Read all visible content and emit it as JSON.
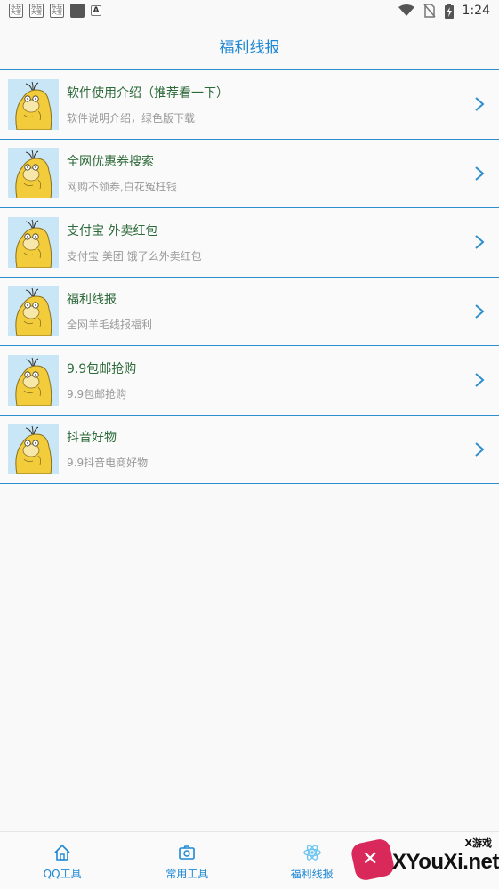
{
  "status_bar": {
    "notification_icons": [
      "app-notification-icon",
      "app-notification-icon",
      "app-notification-icon",
      "dark-square-icon",
      "a-letter-icon"
    ],
    "notif_label": "乐玩大宝",
    "time": "1:24",
    "icons": [
      "wifi-icon",
      "no-sim-icon",
      "battery-charging-icon"
    ]
  },
  "header": {
    "title": "福利线报"
  },
  "list": {
    "items": [
      {
        "title": "软件使用介绍（推荐看一下）",
        "subtitle": "软件说明介绍，绿色版下载"
      },
      {
        "title": "全网优惠券搜索",
        "subtitle": "网购不领券,白花冤枉钱"
      },
      {
        "title": "支付宝 外卖红包",
        "subtitle": "支付宝 美团 饿了么外卖红包"
      },
      {
        "title": "福利线报",
        "subtitle": "全网羊毛线报福利"
      },
      {
        "title": "9.9包邮抢购",
        "subtitle": "9.9包邮抢购"
      },
      {
        "title": "抖音好物",
        "subtitle": "9.9抖音电商好物"
      }
    ]
  },
  "tabbar": {
    "tabs": [
      {
        "label": "QQ工具",
        "icon": "home-icon"
      },
      {
        "label": "常用工具",
        "icon": "camera-icon"
      },
      {
        "label": "福利线报",
        "icon": "atom-icon"
      }
    ]
  },
  "watermark": {
    "top": "X游戏",
    "text": "XYouXi.net"
  },
  "colors": {
    "accent": "#1e88d4",
    "divider": "#2d8ed0",
    "title_text": "#2d6a3a",
    "subtitle_text": "#9a9a9a"
  }
}
